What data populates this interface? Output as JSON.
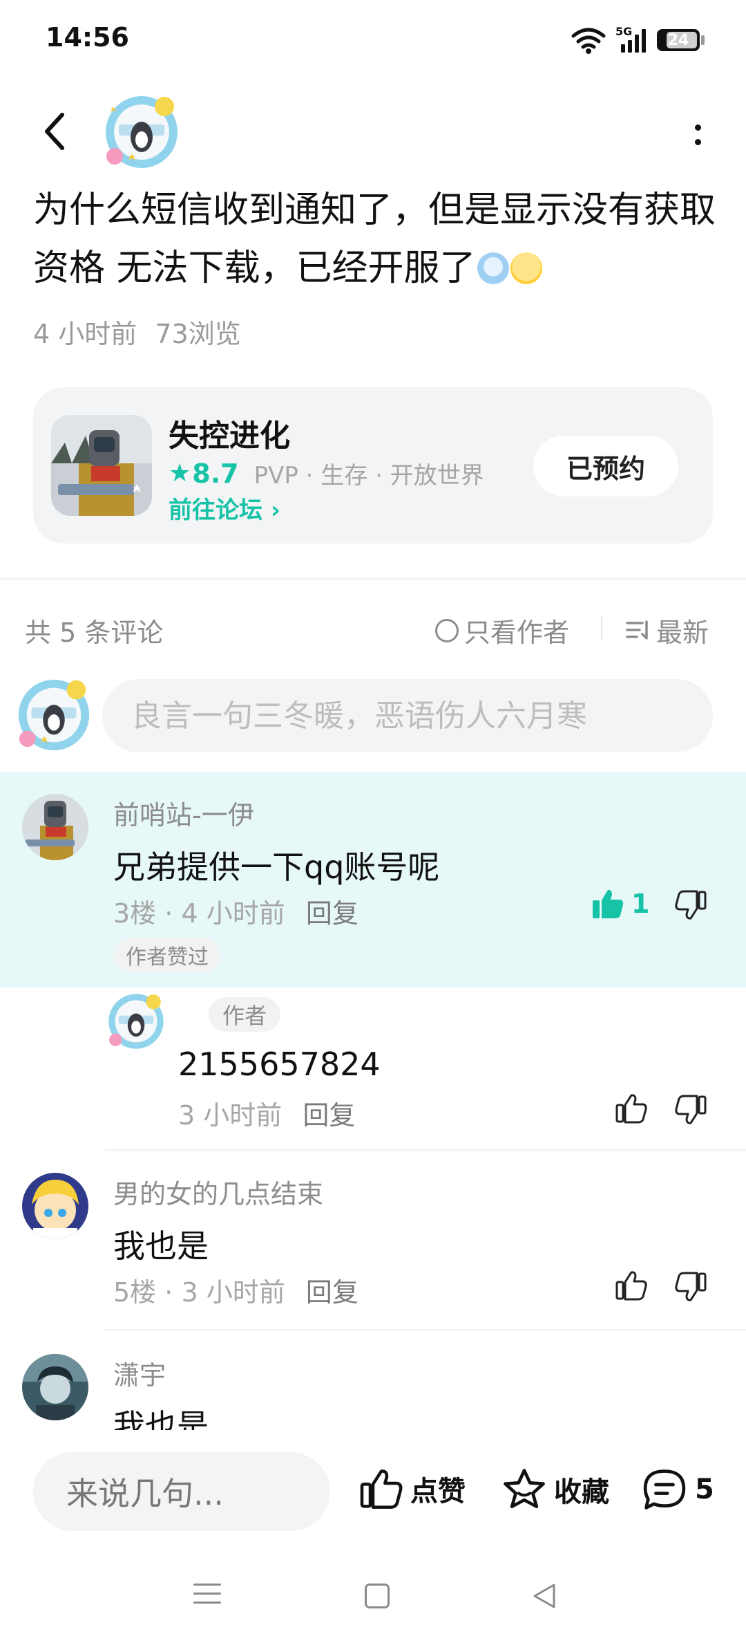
{
  "status_bar": {
    "time": "14:56",
    "network": "5G",
    "battery": "24"
  },
  "header": {
    "back_icon": "chevron-left-icon",
    "more_icon": "more-vertical-icon"
  },
  "post": {
    "title": "为什么短信收到通知了，但是显示没有获取资格  无法下载，已经开服了",
    "time": "4 小时前",
    "views": "73浏览"
  },
  "game_card": {
    "name": "失控进化",
    "rating": "8.7",
    "tags": "PVP · 生存 · 开放世界",
    "forum_link": "前往论坛 ›",
    "reserve_button": "已预约"
  },
  "comments_toolbar": {
    "count_label": "共 5 条评论",
    "only_author_label": "只看作者",
    "sort_label": "最新"
  },
  "comment_input": {
    "placeholder": "良言一句三冬暖，恶语伤人六月寒"
  },
  "comments": [
    {
      "user": "前哨站-一伊",
      "text": "兄弟提供一下qq账号呢",
      "floor": "3楼",
      "time": "4 小时前",
      "reply_label": "回复",
      "likes": "1",
      "badge": "作者赞过"
    },
    {
      "user_tag": "作者",
      "text": "2155657824",
      "time": "3 小时前",
      "reply_label": "回复"
    },
    {
      "user": "男的女的几点结束",
      "text": "我也是",
      "floor": "5楼",
      "time": "3 小时前",
      "reply_label": "回复"
    },
    {
      "user": "潇宇",
      "text": "我也是"
    }
  ],
  "bottom_bar": {
    "input_placeholder": "来说几句...",
    "like_label": "点赞",
    "favorite_label": "收藏",
    "comment_count": "5"
  },
  "colors": {
    "accent": "#16c3a6",
    "highlight": "#e6f8f7"
  }
}
